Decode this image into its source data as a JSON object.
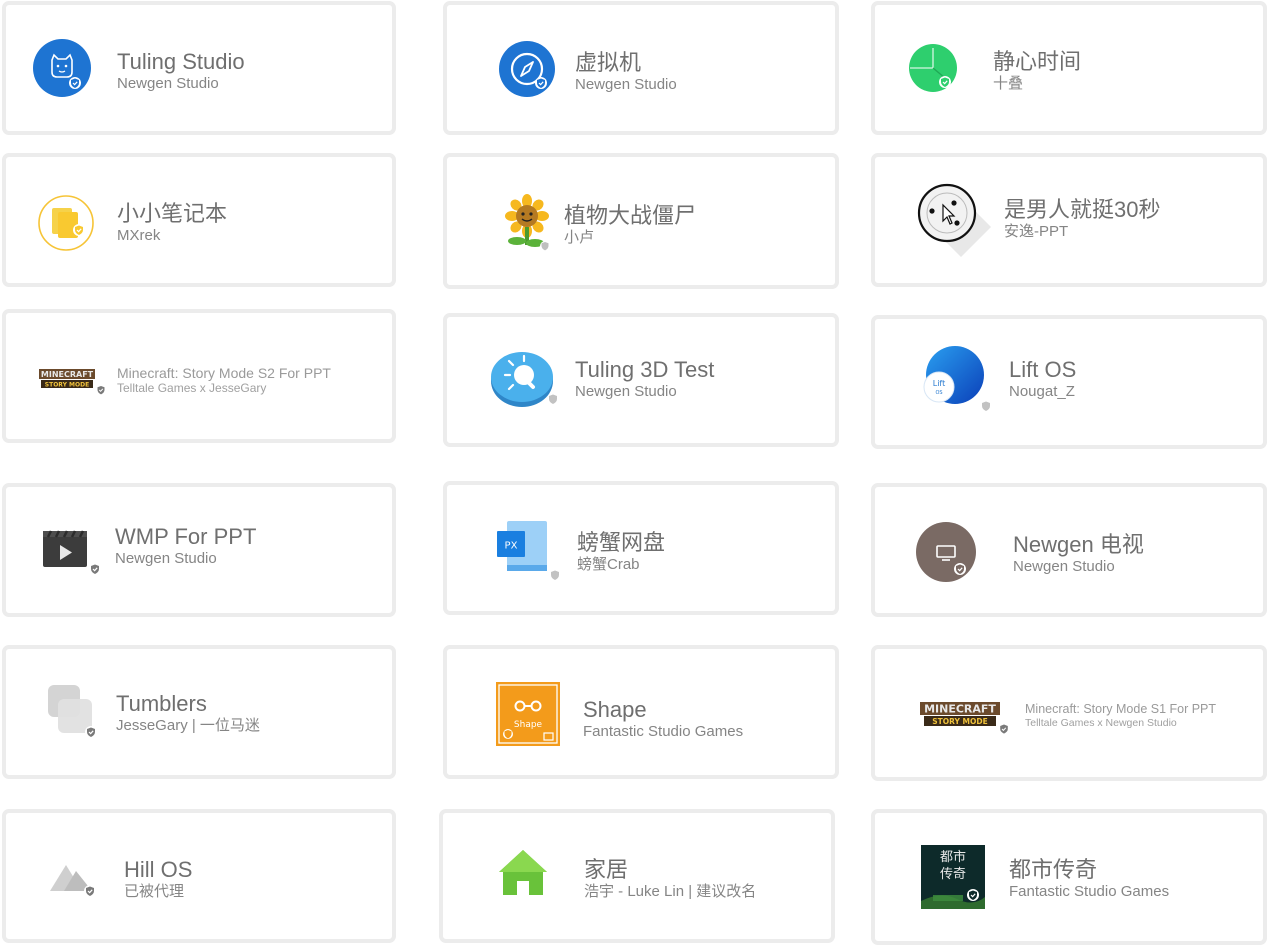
{
  "apps": [
    {
      "title": "Tuling Studio",
      "subtitle": "Newgen Studio",
      "icon": "cat-icon"
    },
    {
      "title": "虚拟机",
      "subtitle": "Newgen Studio",
      "icon": "compass-icon"
    },
    {
      "title": "静心时间",
      "subtitle": "十叠",
      "icon": "clock-icon"
    },
    {
      "title": "小小笔记本",
      "subtitle": "MXrek",
      "icon": "notebook-icon"
    },
    {
      "title": "植物大战僵尸",
      "subtitle": "小卢",
      "icon": "sunflower-icon"
    },
    {
      "title": "是男人就挺30秒",
      "subtitle": "安逸-PPT",
      "icon": "target-cursor-icon"
    },
    {
      "title": "Minecraft: Story Mode S2 For PPT",
      "subtitle": "Telltale Games x JesseGary",
      "icon": "minecraft-logo-icon"
    },
    {
      "title": "Tuling 3D Test",
      "subtitle": "Newgen Studio",
      "icon": "bulb-icon"
    },
    {
      "title": "Lift OS",
      "subtitle": "Nougat_Z",
      "icon": "lift-os-icon"
    },
    {
      "title": "WMP For PPT",
      "subtitle": "Newgen Studio",
      "icon": "video-player-icon"
    },
    {
      "title": "螃蟹网盘",
      "subtitle": "螃蟹Crab",
      "icon": "cloud-drive-icon"
    },
    {
      "title": "Newgen 电视",
      "subtitle": "Newgen Studio",
      "icon": "tv-icon"
    },
    {
      "title": "Tumblers",
      "subtitle": "JesseGary  | 一位马迷",
      "icon": "tumblers-icon"
    },
    {
      "title": "Shape",
      "subtitle": "Fantastic Studio Games",
      "icon": "shape-icon",
      "icon_text": "Shape"
    },
    {
      "title": "Minecraft: Story Mode S1 For PPT",
      "subtitle": "Telltale Games x Newgen Studio",
      "icon": "minecraft-logo-icon"
    },
    {
      "title": "Hill OS",
      "subtitle": "已被代理",
      "icon": "mountain-icon"
    },
    {
      "title": "家居",
      "subtitle": "浩宇 - Luke Lin | 建议改名",
      "icon": "house-icon"
    },
    {
      "title": "都市传奇",
      "subtitle": "Fantastic Studio Games",
      "icon": "city-legend-icon",
      "icon_text": "都市\n传奇"
    }
  ],
  "icon_labels": {
    "minecraft": "MINECRAFT",
    "story_mode": "STORY MODE",
    "px": "PX",
    "lift": "Lift",
    "os": "OS",
    "city_legend_line1": "都市",
    "city_legend_line2": "传奇"
  },
  "colors": {
    "card_border": "#ececec",
    "title": "#6f6f6f",
    "subtitle": "#858585",
    "verified_badge": "#8a8a8a",
    "blue": "#1e74d2"
  }
}
